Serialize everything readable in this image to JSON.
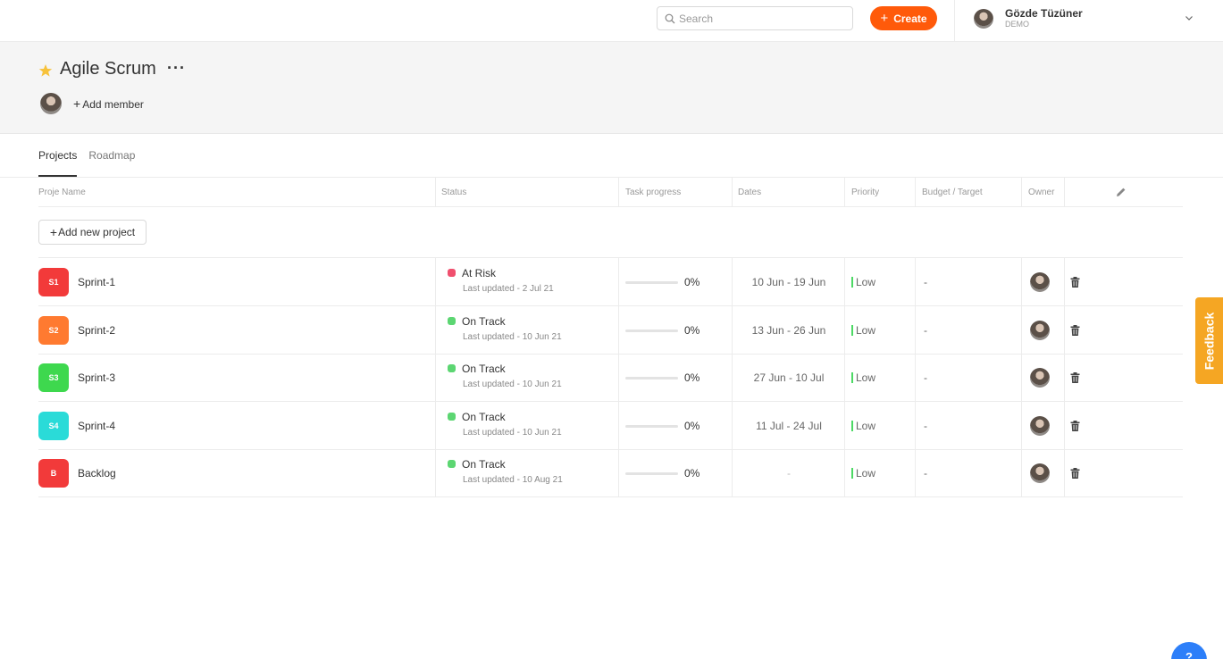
{
  "topbar": {
    "search_placeholder": "Search",
    "create_label": "Create",
    "user": {
      "name": "Gözde Tüzüner",
      "subtitle": "DEMO"
    }
  },
  "header": {
    "title": "Agile Scrum",
    "more": "···",
    "add_member": "Add member"
  },
  "tabs": [
    "Projects",
    "Roadmap"
  ],
  "table": {
    "columns": [
      "Proje Name",
      "Status",
      "Task progress",
      "Dates",
      "Priority",
      "Budget / Target",
      "Owner"
    ],
    "add_project": "Add new project",
    "rows": [
      {
        "badge": "S1",
        "badge_color": "#f23a3a",
        "name": "Sprint-1",
        "status": "At Risk",
        "status_color": "#f0506e",
        "updated": "Last updated - 2 Jul 21",
        "progress": 0,
        "progress_label": "0%",
        "dates": "10 Jun - 19 Jun",
        "priority": "Low",
        "budget": "-"
      },
      {
        "badge": "S2",
        "badge_color": "#ff7a30",
        "name": "Sprint-2",
        "status": "On Track",
        "status_color": "#5cd672",
        "updated": "Last updated - 10 Jun 21",
        "progress": 0,
        "progress_label": "0%",
        "dates": "13 Jun - 26 Jun",
        "priority": "Low",
        "budget": "-"
      },
      {
        "badge": "S3",
        "badge_color": "#3ed84e",
        "name": "Sprint-3",
        "status": "On Track",
        "status_color": "#5cd672",
        "updated": "Last updated - 10 Jun 21",
        "progress": 0,
        "progress_label": "0%",
        "dates": "27 Jun - 10 Jul",
        "priority": "Low",
        "budget": "-"
      },
      {
        "badge": "S4",
        "badge_color": "#2adbd8",
        "name": "Sprint-4",
        "status": "On Track",
        "status_color": "#5cd672",
        "updated": "Last updated - 10 Jun 21",
        "progress": 0,
        "progress_label": "0%",
        "dates": "11 Jul - 24 Jul",
        "priority": "Low",
        "budget": "-"
      },
      {
        "badge": "B",
        "badge_color": "#f23a3a",
        "name": "Backlog",
        "status": "On Track",
        "status_color": "#5cd672",
        "updated": "Last updated - 10 Aug 21",
        "progress": 0,
        "progress_label": "0%",
        "dates": "-",
        "priority": "Low",
        "budget": "-"
      }
    ]
  },
  "feedback_label": "Feedback",
  "help_label": "?",
  "colors": {
    "accent": "#ff5a0a",
    "feedback": "#f5a623",
    "help": "#2d7ff9",
    "priority_low": "#4cd964"
  }
}
